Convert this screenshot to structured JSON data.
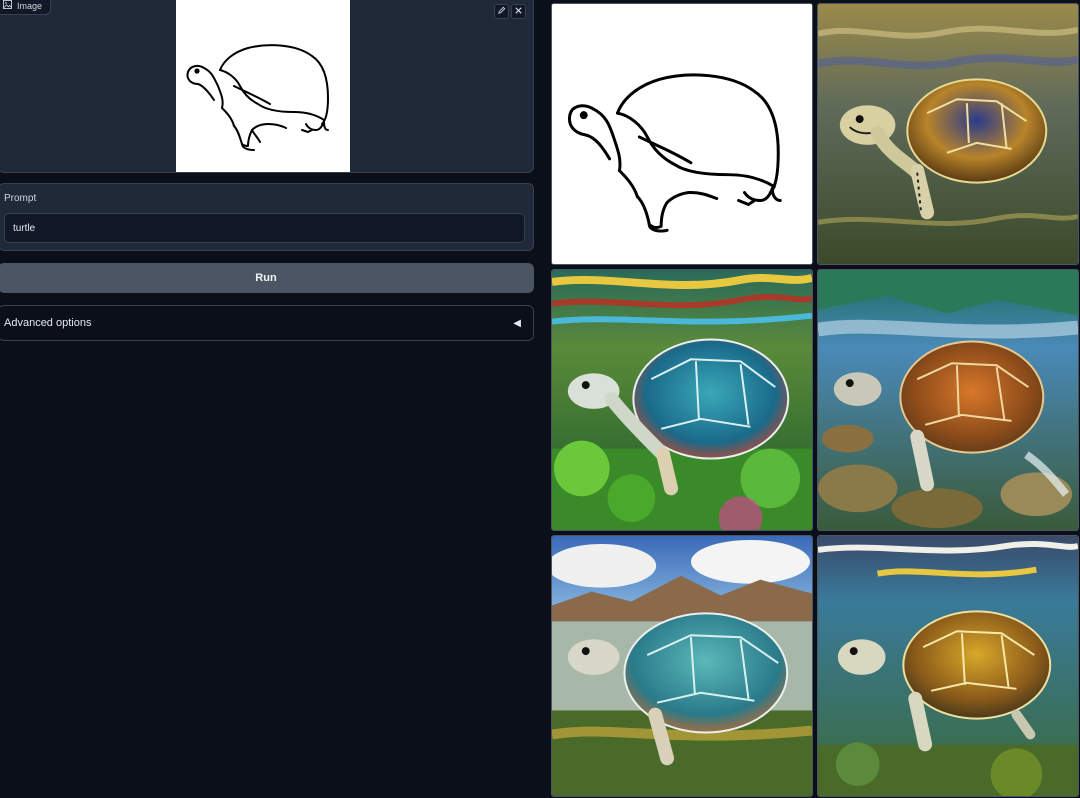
{
  "image_panel": {
    "label": "Image",
    "icons": [
      "image-icon",
      "pencil-icon",
      "close-icon"
    ]
  },
  "prompt": {
    "label": "Prompt",
    "value": "turtle"
  },
  "run_button": {
    "label": "Run"
  },
  "advanced_options": {
    "label": "Advanced options",
    "caret": "◀"
  },
  "gallery": {
    "items": [
      {
        "name": "sketch-output",
        "style": "line drawing"
      },
      {
        "name": "turtle-water-1"
      },
      {
        "name": "turtle-reef"
      },
      {
        "name": "turtle-rocks"
      },
      {
        "name": "turtle-mountains"
      },
      {
        "name": "turtle-underwater"
      }
    ]
  },
  "colors": {
    "background": "#0b0f19",
    "panel": "#1f2937",
    "border": "#374151",
    "button": "#4b5563"
  }
}
